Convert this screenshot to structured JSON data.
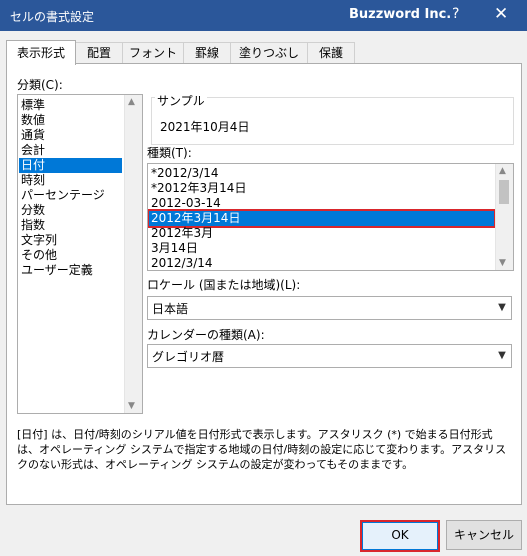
{
  "window": {
    "title": "セルの書式設定",
    "company": "Buzzword Inc.",
    "help": "?",
    "close": "✕"
  },
  "tabs": [
    {
      "label": "表示形式",
      "active": true
    },
    {
      "label": "配置"
    },
    {
      "label": "フォント"
    },
    {
      "label": "罫線"
    },
    {
      "label": "塗りつぶし"
    },
    {
      "label": "保護"
    }
  ],
  "category": {
    "label": "分類(C):",
    "items": [
      "標準",
      "数値",
      "通貨",
      "会計",
      "日付",
      "時刻",
      "パーセンテージ",
      "分数",
      "指数",
      "文字列",
      "その他",
      "ユーザー定義"
    ],
    "selected": "日付"
  },
  "sample": {
    "label": "サンプル",
    "value": "2021年10月4日"
  },
  "type": {
    "label": "種類(T):",
    "items": [
      "*2012/3/14",
      "*2012年3月14日",
      "2012-03-14",
      "2012年3月14日",
      "2012年3月",
      "3月14日",
      "2012/3/14"
    ],
    "selected": "2012年3月14日"
  },
  "locale": {
    "label": "ロケール (国または地域)(L):",
    "value": "日本語"
  },
  "calendar": {
    "label": "カレンダーの種類(A):",
    "value": "グレゴリオ暦"
  },
  "description": "[日付] は、日付/時刻のシリアル値を日付形式で表示します。アスタリスク (*) で始まる日付形式は、オペレーティング システムで指定する地域の日付/時刻の設定に応じて変わります。アスタリスクのない形式は、オペレーティング システムの設定が変わってもそのままです。",
  "buttons": {
    "ok": "OK",
    "cancel": "キャンセル"
  },
  "colors": {
    "titlebar": "#2b579a",
    "selection": "#0078d7",
    "highlight_box": "#d9262c"
  }
}
